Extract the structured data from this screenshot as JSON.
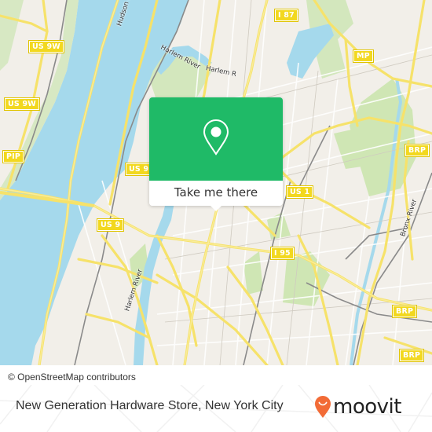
{
  "map": {
    "attribution": "© OpenStreetMap contributors",
    "colors": {
      "water": "#a5d9ec",
      "park": "#cfe6b4",
      "land": "#f2efe9",
      "road_major": "#f6e26a",
      "road_minor": "#ffffff",
      "rail": "#8a8a8a"
    },
    "shields": [
      {
        "label": "US 9W"
      },
      {
        "label": "US 9W"
      },
      {
        "label": "PIP"
      },
      {
        "label": "US 9"
      },
      {
        "label": "US 9"
      },
      {
        "label": "I 87"
      },
      {
        "label": "MP"
      },
      {
        "label": "BRP"
      },
      {
        "label": "US 1"
      },
      {
        "label": "I 95"
      },
      {
        "label": "BRP"
      },
      {
        "label": "BRP"
      }
    ],
    "water_labels": [
      {
        "label": "Hudson River"
      },
      {
        "label": "Harlem River"
      },
      {
        "label": "Harlem R"
      },
      {
        "label": "Harlem River"
      },
      {
        "label": "Bronx River"
      }
    ]
  },
  "popup": {
    "button_label": "Take me there",
    "pin_icon": "map-pin-icon",
    "color": "#1fba67"
  },
  "footer": {
    "place_title": "New Generation Hardware Store, New York City",
    "brand": "moovit",
    "brand_color": "#f26b36"
  }
}
